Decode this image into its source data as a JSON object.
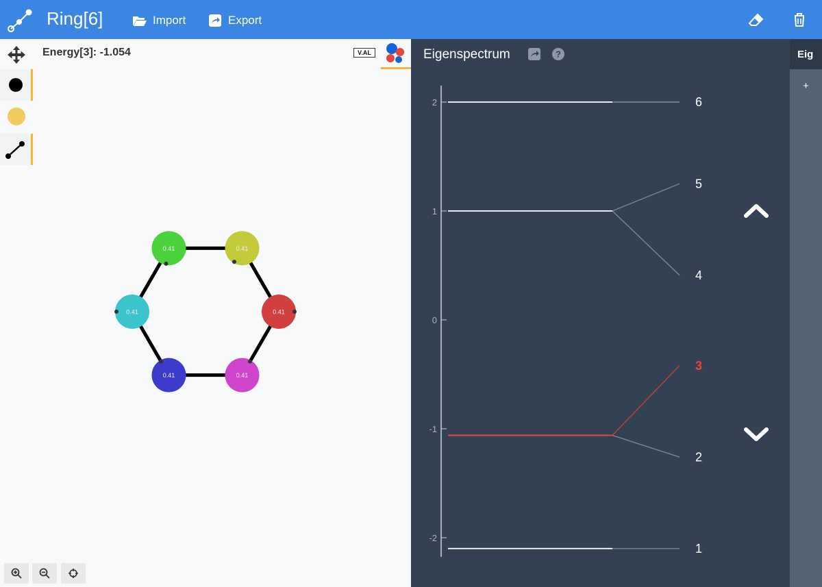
{
  "header": {
    "title": "Ring[6]",
    "import_label": "Import",
    "export_label": "Export"
  },
  "canvas": {
    "energy_label": "Energy[3]: -1.054",
    "val_toggle": "V.AL",
    "nodes": [
      {
        "value": "0.41",
        "color": "#4bd13c"
      },
      {
        "value": "0.41",
        "color": "#c3cb3a"
      },
      {
        "value": "0.41",
        "color": "#d1403e"
      },
      {
        "value": "0.41",
        "color": "#cf44cd"
      },
      {
        "value": "0.41",
        "color": "#3d3bcb"
      },
      {
        "value": "0.41",
        "color": "#3cc4cb"
      }
    ]
  },
  "panel": {
    "title": "Eigenspectrum",
    "tab_label": "Eig",
    "add_label": "+",
    "axis_ticks": [
      "2",
      "1",
      "0",
      "-1",
      "-2"
    ],
    "levels": [
      {
        "label": "6",
        "energy": 2.0,
        "group_energy": 2.0
      },
      {
        "label": "5",
        "energy": 1.25,
        "group_energy": 1.0
      },
      {
        "label": "4",
        "energy": 0.41,
        "group_energy": 1.0
      },
      {
        "label": "3",
        "energy": -0.42,
        "group_energy": -1.06,
        "selected": true
      },
      {
        "label": "2",
        "energy": -1.26,
        "group_energy": -1.06
      },
      {
        "label": "1",
        "energy": -2.1,
        "group_energy": -2.1
      }
    ],
    "highlight_color": "#e8443a"
  }
}
